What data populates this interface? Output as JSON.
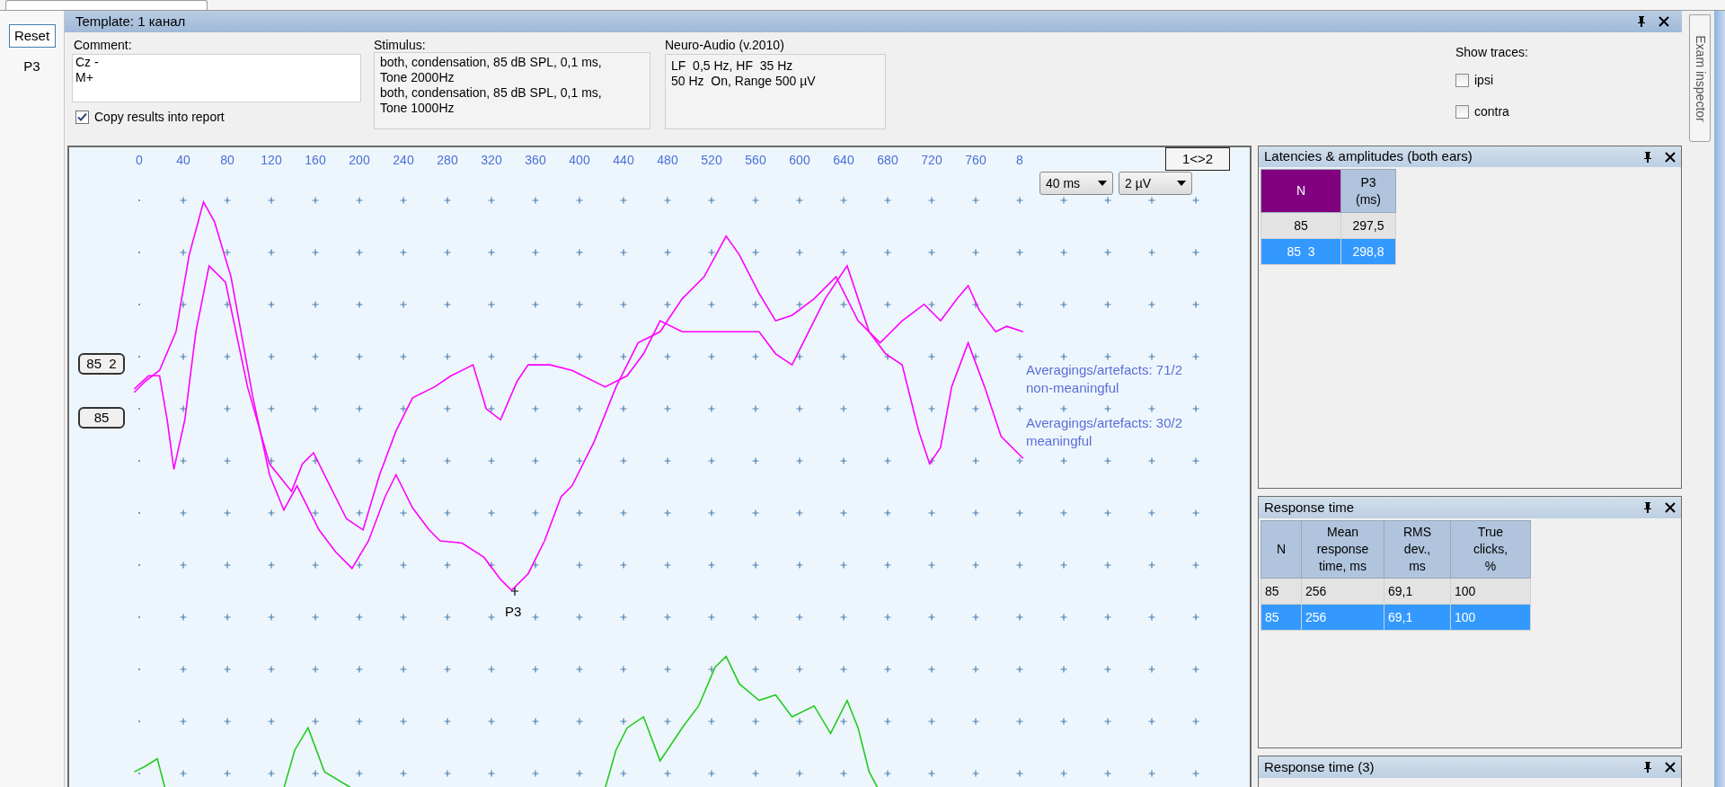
{
  "left_panel": {
    "button": "Reset",
    "items": [
      "P3"
    ]
  },
  "window": {
    "title": "Template: 1 канал"
  },
  "comment": {
    "label": "Comment:",
    "value": "Cz -\nM+"
  },
  "copy_results": {
    "label": "Copy results into report",
    "checked": true
  },
  "stimulus": {
    "label": "Stimulus:",
    "lines": [
      "both, condensation, 85 dB SPL, 0,1 ms,",
      "Tone 2000Hz",
      "both, condensation, 85 dB SPL, 0,1 ms,",
      "Tone 1000Hz"
    ]
  },
  "device": {
    "label": "Neuro-Audio (v.2010)",
    "lines": [
      "LF  0,5 Hz, HF  35 Hz",
      "50 Hz  On, Range 500 µV"
    ]
  },
  "show_traces": {
    "label": "Show traces:",
    "options": [
      {
        "label": "ipsi",
        "checked": false
      },
      {
        "label": "contra",
        "checked": false
      }
    ]
  },
  "plot": {
    "x_labels": [
      "0",
      "40",
      "80",
      "120",
      "160",
      "200",
      "240",
      "280",
      "320",
      "360",
      "400",
      "440",
      "480",
      "520",
      "560",
      "600",
      "640",
      "680",
      "720",
      "760",
      "8"
    ],
    "selects": [
      "40 ms",
      "2 µV"
    ],
    "swap_button": "1<>2",
    "trace_labels": [
      "85  2",
      "85"
    ],
    "annotations": [
      {
        "lines": [
          "Averagings/artefacts: 71/2",
          "non-meaningful"
        ]
      },
      {
        "lines": [
          "Averagings/artefacts: 30/2",
          "meaningful"
        ]
      }
    ],
    "peak_label": "P3"
  },
  "latencies": {
    "title": "Latencies & amplitudes (both ears)",
    "columns": [
      "N",
      "P3\n(ms)"
    ],
    "rows": [
      {
        "cells": [
          "85",
          "297,5"
        ],
        "selected": false
      },
      {
        "cells": [
          "85  3",
          "298,8"
        ],
        "selected": true
      }
    ]
  },
  "response_time": {
    "title": "Response time",
    "columns": [
      "N",
      "Mean\nresponse\ntime, ms",
      "RMS\ndev.,\nms",
      "True\nclicks,\n%"
    ],
    "rows": [
      {
        "cells": [
          "85",
          "256",
          "69,1",
          "100"
        ],
        "selected": false
      },
      {
        "cells": [
          "85",
          "256",
          "69,1",
          "100"
        ],
        "selected": true
      }
    ]
  },
  "response_time_3": {
    "title": "Response time (3)"
  },
  "side_tab": {
    "label": "Exam inspector"
  }
}
